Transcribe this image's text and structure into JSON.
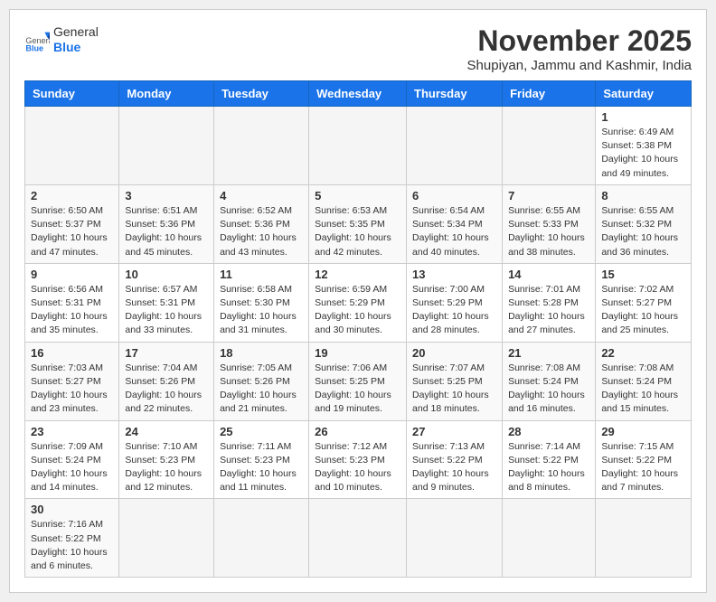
{
  "header": {
    "logo_general": "General",
    "logo_blue": "Blue",
    "month_title": "November 2025",
    "subtitle": "Shupiyan, Jammu and Kashmir, India"
  },
  "weekdays": [
    "Sunday",
    "Monday",
    "Tuesday",
    "Wednesday",
    "Thursday",
    "Friday",
    "Saturday"
  ],
  "weeks": [
    [
      {
        "day": "",
        "info": ""
      },
      {
        "day": "",
        "info": ""
      },
      {
        "day": "",
        "info": ""
      },
      {
        "day": "",
        "info": ""
      },
      {
        "day": "",
        "info": ""
      },
      {
        "day": "",
        "info": ""
      },
      {
        "day": "1",
        "info": "Sunrise: 6:49 AM\nSunset: 5:38 PM\nDaylight: 10 hours\nand 49 minutes."
      }
    ],
    [
      {
        "day": "2",
        "info": "Sunrise: 6:50 AM\nSunset: 5:37 PM\nDaylight: 10 hours\nand 47 minutes."
      },
      {
        "day": "3",
        "info": "Sunrise: 6:51 AM\nSunset: 5:36 PM\nDaylight: 10 hours\nand 45 minutes."
      },
      {
        "day": "4",
        "info": "Sunrise: 6:52 AM\nSunset: 5:36 PM\nDaylight: 10 hours\nand 43 minutes."
      },
      {
        "day": "5",
        "info": "Sunrise: 6:53 AM\nSunset: 5:35 PM\nDaylight: 10 hours\nand 42 minutes."
      },
      {
        "day": "6",
        "info": "Sunrise: 6:54 AM\nSunset: 5:34 PM\nDaylight: 10 hours\nand 40 minutes."
      },
      {
        "day": "7",
        "info": "Sunrise: 6:55 AM\nSunset: 5:33 PM\nDaylight: 10 hours\nand 38 minutes."
      },
      {
        "day": "8",
        "info": "Sunrise: 6:55 AM\nSunset: 5:32 PM\nDaylight: 10 hours\nand 36 minutes."
      }
    ],
    [
      {
        "day": "9",
        "info": "Sunrise: 6:56 AM\nSunset: 5:31 PM\nDaylight: 10 hours\nand 35 minutes."
      },
      {
        "day": "10",
        "info": "Sunrise: 6:57 AM\nSunset: 5:31 PM\nDaylight: 10 hours\nand 33 minutes."
      },
      {
        "day": "11",
        "info": "Sunrise: 6:58 AM\nSunset: 5:30 PM\nDaylight: 10 hours\nand 31 minutes."
      },
      {
        "day": "12",
        "info": "Sunrise: 6:59 AM\nSunset: 5:29 PM\nDaylight: 10 hours\nand 30 minutes."
      },
      {
        "day": "13",
        "info": "Sunrise: 7:00 AM\nSunset: 5:29 PM\nDaylight: 10 hours\nand 28 minutes."
      },
      {
        "day": "14",
        "info": "Sunrise: 7:01 AM\nSunset: 5:28 PM\nDaylight: 10 hours\nand 27 minutes."
      },
      {
        "day": "15",
        "info": "Sunrise: 7:02 AM\nSunset: 5:27 PM\nDaylight: 10 hours\nand 25 minutes."
      }
    ],
    [
      {
        "day": "16",
        "info": "Sunrise: 7:03 AM\nSunset: 5:27 PM\nDaylight: 10 hours\nand 23 minutes."
      },
      {
        "day": "17",
        "info": "Sunrise: 7:04 AM\nSunset: 5:26 PM\nDaylight: 10 hours\nand 22 minutes."
      },
      {
        "day": "18",
        "info": "Sunrise: 7:05 AM\nSunset: 5:26 PM\nDaylight: 10 hours\nand 21 minutes."
      },
      {
        "day": "19",
        "info": "Sunrise: 7:06 AM\nSunset: 5:25 PM\nDaylight: 10 hours\nand 19 minutes."
      },
      {
        "day": "20",
        "info": "Sunrise: 7:07 AM\nSunset: 5:25 PM\nDaylight: 10 hours\nand 18 minutes."
      },
      {
        "day": "21",
        "info": "Sunrise: 7:08 AM\nSunset: 5:24 PM\nDaylight: 10 hours\nand 16 minutes."
      },
      {
        "day": "22",
        "info": "Sunrise: 7:08 AM\nSunset: 5:24 PM\nDaylight: 10 hours\nand 15 minutes."
      }
    ],
    [
      {
        "day": "23",
        "info": "Sunrise: 7:09 AM\nSunset: 5:24 PM\nDaylight: 10 hours\nand 14 minutes."
      },
      {
        "day": "24",
        "info": "Sunrise: 7:10 AM\nSunset: 5:23 PM\nDaylight: 10 hours\nand 12 minutes."
      },
      {
        "day": "25",
        "info": "Sunrise: 7:11 AM\nSunset: 5:23 PM\nDaylight: 10 hours\nand 11 minutes."
      },
      {
        "day": "26",
        "info": "Sunrise: 7:12 AM\nSunset: 5:23 PM\nDaylight: 10 hours\nand 10 minutes."
      },
      {
        "day": "27",
        "info": "Sunrise: 7:13 AM\nSunset: 5:22 PM\nDaylight: 10 hours\nand 9 minutes."
      },
      {
        "day": "28",
        "info": "Sunrise: 7:14 AM\nSunset: 5:22 PM\nDaylight: 10 hours\nand 8 minutes."
      },
      {
        "day": "29",
        "info": "Sunrise: 7:15 AM\nSunset: 5:22 PM\nDaylight: 10 hours\nand 7 minutes."
      }
    ],
    [
      {
        "day": "30",
        "info": "Sunrise: 7:16 AM\nSunset: 5:22 PM\nDaylight: 10 hours\nand 6 minutes."
      },
      {
        "day": "",
        "info": ""
      },
      {
        "day": "",
        "info": ""
      },
      {
        "day": "",
        "info": ""
      },
      {
        "day": "",
        "info": ""
      },
      {
        "day": "",
        "info": ""
      },
      {
        "day": "",
        "info": ""
      }
    ]
  ]
}
